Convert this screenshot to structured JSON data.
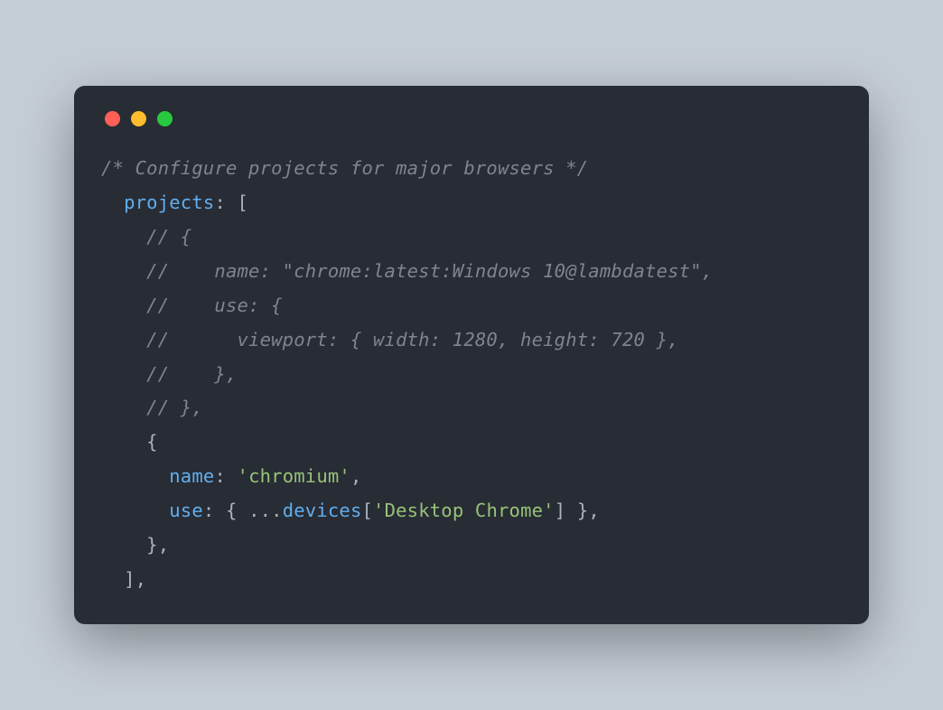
{
  "code": {
    "line1": "/* Configure projects for major browsers */",
    "line2_key": "projects",
    "line2_rest": ": [",
    "line3": "// {",
    "line4": "//    name: \"chrome:latest:Windows 10@lambdatest\",",
    "line5": "//    use: {",
    "line6": "//      viewport: { width: 1280, height: 720 },",
    "line7": "//    },",
    "line8": "// },",
    "line9": "{",
    "line10_key": "name",
    "line10_colon": ": ",
    "line10_val": "'chromium'",
    "line10_comma": ",",
    "line11_key": "use",
    "line11_open": ": { ...",
    "line11_ident": "devices",
    "line11_lbracket": "[",
    "line11_str": "'Desktop Chrome'",
    "line11_rbracket": "] },",
    "line12": "},",
    "line13": "],"
  }
}
